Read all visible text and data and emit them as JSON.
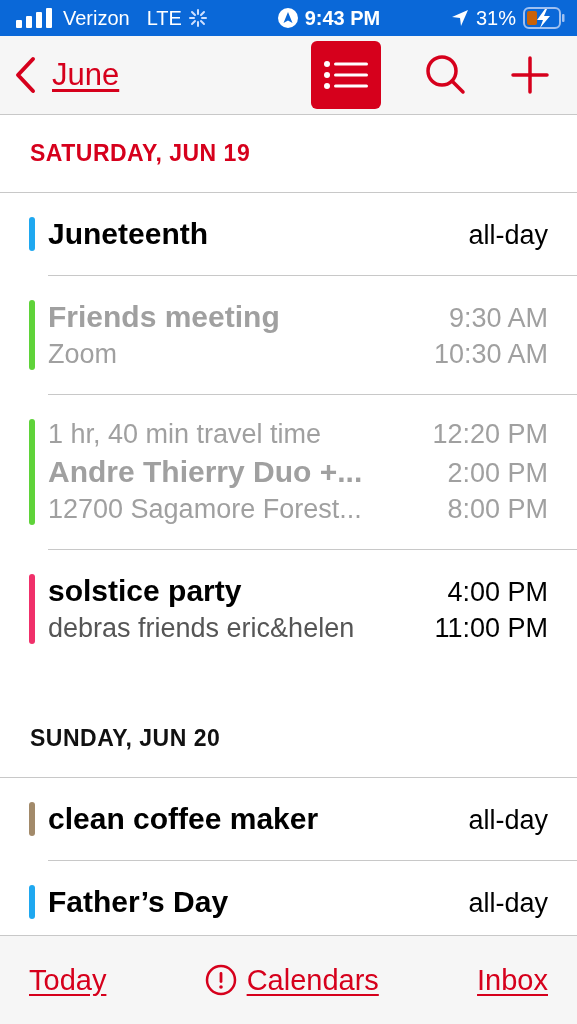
{
  "status_bar": {
    "carrier": "Verizon",
    "network": "LTE",
    "time": "9:43 PM",
    "battery": "31%"
  },
  "nav": {
    "back_label": "June",
    "list_view_selected": true
  },
  "sections": [
    {
      "date": "SATURDAY, JUN 19",
      "today": true,
      "events": [
        {
          "color": "#1fa8f0",
          "dimmed": false,
          "title": "Juneteenth",
          "times": [
            "all-day"
          ]
        },
        {
          "color": "#5fd33a",
          "dimmed": true,
          "title": "Friends meeting",
          "location": "Zoom",
          "times": [
            "9:30 AM",
            "10:30 AM"
          ]
        },
        {
          "color": "#5fd33a",
          "dimmed": true,
          "travel": "1 hr, 40 min travel time",
          "title": "Andre Thierry Duo +...",
          "location": "12700 Sagamore Forest...",
          "times": [
            "12:20 PM",
            "2:00 PM",
            "8:00 PM"
          ]
        },
        {
          "color": "#f0306a",
          "dimmed": false,
          "title": "solstice party",
          "location": "debras friends eric&helen",
          "times": [
            "4:00 PM",
            "11:00 PM"
          ]
        }
      ]
    },
    {
      "date": "SUNDAY, JUN 20",
      "today": false,
      "events": [
        {
          "color": "#a28a6a",
          "dimmed": false,
          "title": "clean coffee maker",
          "times": [
            "all-day"
          ]
        },
        {
          "color": "#1fa8f0",
          "dimmed": false,
          "title": "Father’s Day",
          "times": [
            "all-day"
          ]
        }
      ]
    }
  ],
  "tab_bar": {
    "today": "Today",
    "calendars": "Calendars",
    "inbox": "Inbox"
  }
}
